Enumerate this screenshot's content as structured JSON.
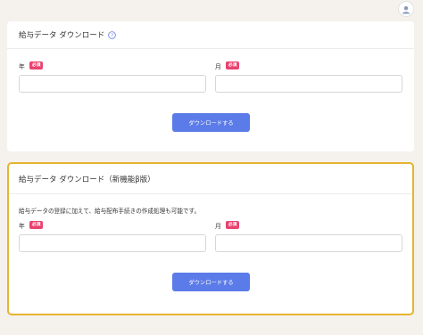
{
  "header": {
    "avatar_icon": "user-icon"
  },
  "section1": {
    "title": "給与データ ダウンロード",
    "help_icon": "question-circle-icon",
    "year_label": "年",
    "month_label": "月",
    "required_badge": "必須",
    "year_value": "",
    "month_value": "",
    "download_button": "ダウンロードする"
  },
  "section2": {
    "title": "給与データ ダウンロード（新機能β版）",
    "description": "給与データの登録に加えて、給与配布手続きの作成処理も可能です。",
    "year_label": "年",
    "month_label": "月",
    "required_badge": "必須",
    "year_value": "",
    "month_value": "",
    "download_button": "ダウンロードする"
  },
  "colors": {
    "primary_button": "#5b7be8",
    "required_badge": "#e9426e",
    "highlight_border": "#e6b42e",
    "page_background": "#f5f2ee"
  }
}
